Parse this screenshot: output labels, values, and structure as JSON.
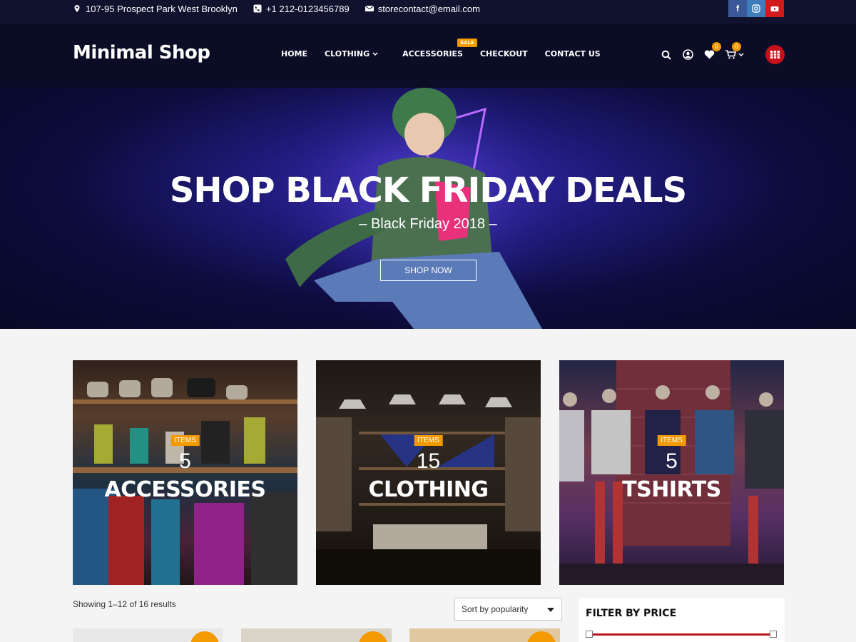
{
  "topbar": {
    "address": "107-95 Prospect Park West Brooklyn",
    "phone": "+1 212-0123456789",
    "email": "storecontact@email.com",
    "social": [
      "facebook-icon",
      "instagram-icon",
      "youtube-icon"
    ]
  },
  "header": {
    "logo": "Minimal Shop",
    "nav": {
      "home": "HOME",
      "clothing": "CLOTHING",
      "accessories": "ACCESSORIES",
      "sale_badge": "SALE",
      "checkout": "CHECKOUT",
      "contact": "CONTACT US"
    },
    "wishlist_count": "0",
    "cart_count": "0"
  },
  "hero": {
    "title": "SHOP BLACK FRIDAY DEALS",
    "subtitle": "– Black Friday 2018 –",
    "button": "SHOP NOW"
  },
  "categories": [
    {
      "tag": "ITEMS",
      "count": "5",
      "name": "ACCESSORIES"
    },
    {
      "tag": "ITEMS",
      "count": "15",
      "name": "CLOTHING"
    },
    {
      "tag": "ITEMS",
      "count": "5",
      "name": "TSHIRTS"
    }
  ],
  "shop": {
    "showing": "Showing 1–12 of 16 results",
    "sort_selected": "Sort by popularity"
  },
  "filter": {
    "title": "FILTER BY PRICE"
  },
  "colors": {
    "accent": "#f29a00",
    "topbar": "#10122e",
    "header": "#0b0c26",
    "price_track": "#b8141c"
  }
}
